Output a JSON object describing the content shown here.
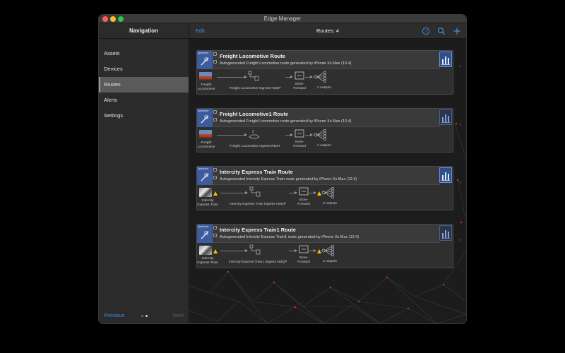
{
  "window": {
    "title": "Edge Manager"
  },
  "sidebar": {
    "title": "Navigation",
    "items": [
      {
        "label": "Assets",
        "active": false
      },
      {
        "label": "Devices",
        "active": false
      },
      {
        "label": "Routes",
        "active": true
      },
      {
        "label": "Alerts",
        "active": false
      },
      {
        "label": "Settings",
        "active": false
      }
    ],
    "footer": {
      "previous": "Previous",
      "next": "Next"
    }
  },
  "toolbar": {
    "edit": "Edit",
    "title": "Routes: 4",
    "icons": [
      "help-icon",
      "search-icon",
      "add-icon"
    ]
  },
  "colors": {
    "accent": "#3f8ee0",
    "appliance": "#3d5c9e",
    "warning": "#f2c200",
    "node": "#e02a2a"
  },
  "routes": [
    {
      "appliance_label": "Appliance",
      "title": "Freight Locomotive Route",
      "description": "Autogenerated Freight Locomotive route generated by iPhone Xs Max (13.4)",
      "source_line1": "Freight",
      "source_line2": "Locomotive",
      "ingress": "Freight Locomotive Ingress AMQP",
      "store_line1": "Store-",
      "store_line2": "Forward",
      "outputs": "2 outputs",
      "warning": false
    },
    {
      "appliance_label": "Appliance",
      "title": "Freight Locomotive1 Route",
      "description": "Autogenerated Freight Locomotive route generated by iPhone Xs Max (13.4)",
      "source_line1": "Freight",
      "source_line2": "Locomotive",
      "ingress": "Freight Locomotive Ingress REST",
      "store_line1": "Store-",
      "store_line2": "Forward",
      "outputs": "2 outputs",
      "warning": false
    },
    {
      "appliance_label": "Appliance",
      "title": "Intercity Express Train Route",
      "description": "Autogenerated Intercity Express Train route generated by iPhone Xs Max (13.4)",
      "source_line1": "Intercity",
      "source_line2": "Express Train",
      "ingress": "Intercity Express Train Ingress AMQP",
      "store_line1": "Store-",
      "store_line2": "Forward",
      "outputs": "2 outputs",
      "warning": true
    },
    {
      "appliance_label": "Appliance",
      "title": "Intercity Express Train1 Route",
      "description": "Autogenerated Intercity Express Train1 route generated by iPhone Xs Max (13.4)",
      "source_line1": "Intercity",
      "source_line2": "Express Train",
      "ingress": "Intercity Express Train1 Ingress AMQP",
      "store_line1": "Store-",
      "store_line2": "Forward",
      "outputs": "2 outputs",
      "warning": true
    }
  ]
}
